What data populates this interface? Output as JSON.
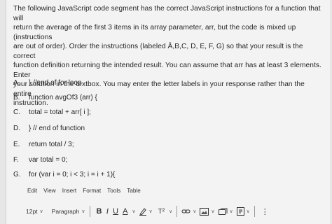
{
  "question": {
    "line1": "The following JavaScript code segment has the correct JavaScript instructions for a function that will",
    "line2": "return the average of the first 3 items in its array parameter, arr, but the code is mixed up (instructions",
    "line3": "are out of order). Order the instructions (labeled Ā,B,C, D, E, F, G) so that your result is the correct",
    "line4": "function definition returning the intended result. You can assume that arr has at least 3 elements. Enter",
    "line5": "your solution in the textbox. You may enter the letter labels in your response rather than the entire",
    "line6": "instruction."
  },
  "options": [
    {
      "letter": "A.",
      "code": "} //end of for loop"
    },
    {
      "letter": "B.",
      "code": "function avgOf3 (arr) {"
    },
    {
      "letter": "C.",
      "code": "total = total + arr[ i ];"
    },
    {
      "letter": "D.",
      "code": "} // end of function"
    },
    {
      "letter": "E.",
      "code": "return total / 3;"
    },
    {
      "letter": "F.",
      "code": "var total = 0;"
    },
    {
      "letter": "G.",
      "code": "for (var i = 0; i < 3; i = i + 1){"
    }
  ],
  "menu": [
    "Edit",
    "View",
    "Insert",
    "Format",
    "Tools",
    "Table"
  ],
  "toolbar": {
    "font_size": "12pt",
    "block_format": "Paragraph",
    "bold": "B",
    "italic": "I",
    "underline": "U",
    "text_color": "A",
    "superscript": "T²",
    "more": "⋮"
  },
  "icons": [
    "chevron-down-icon",
    "highlighter-icon",
    "link-icon",
    "image-icon",
    "media-icon",
    "document-icon",
    "more-vertical-icon"
  ]
}
